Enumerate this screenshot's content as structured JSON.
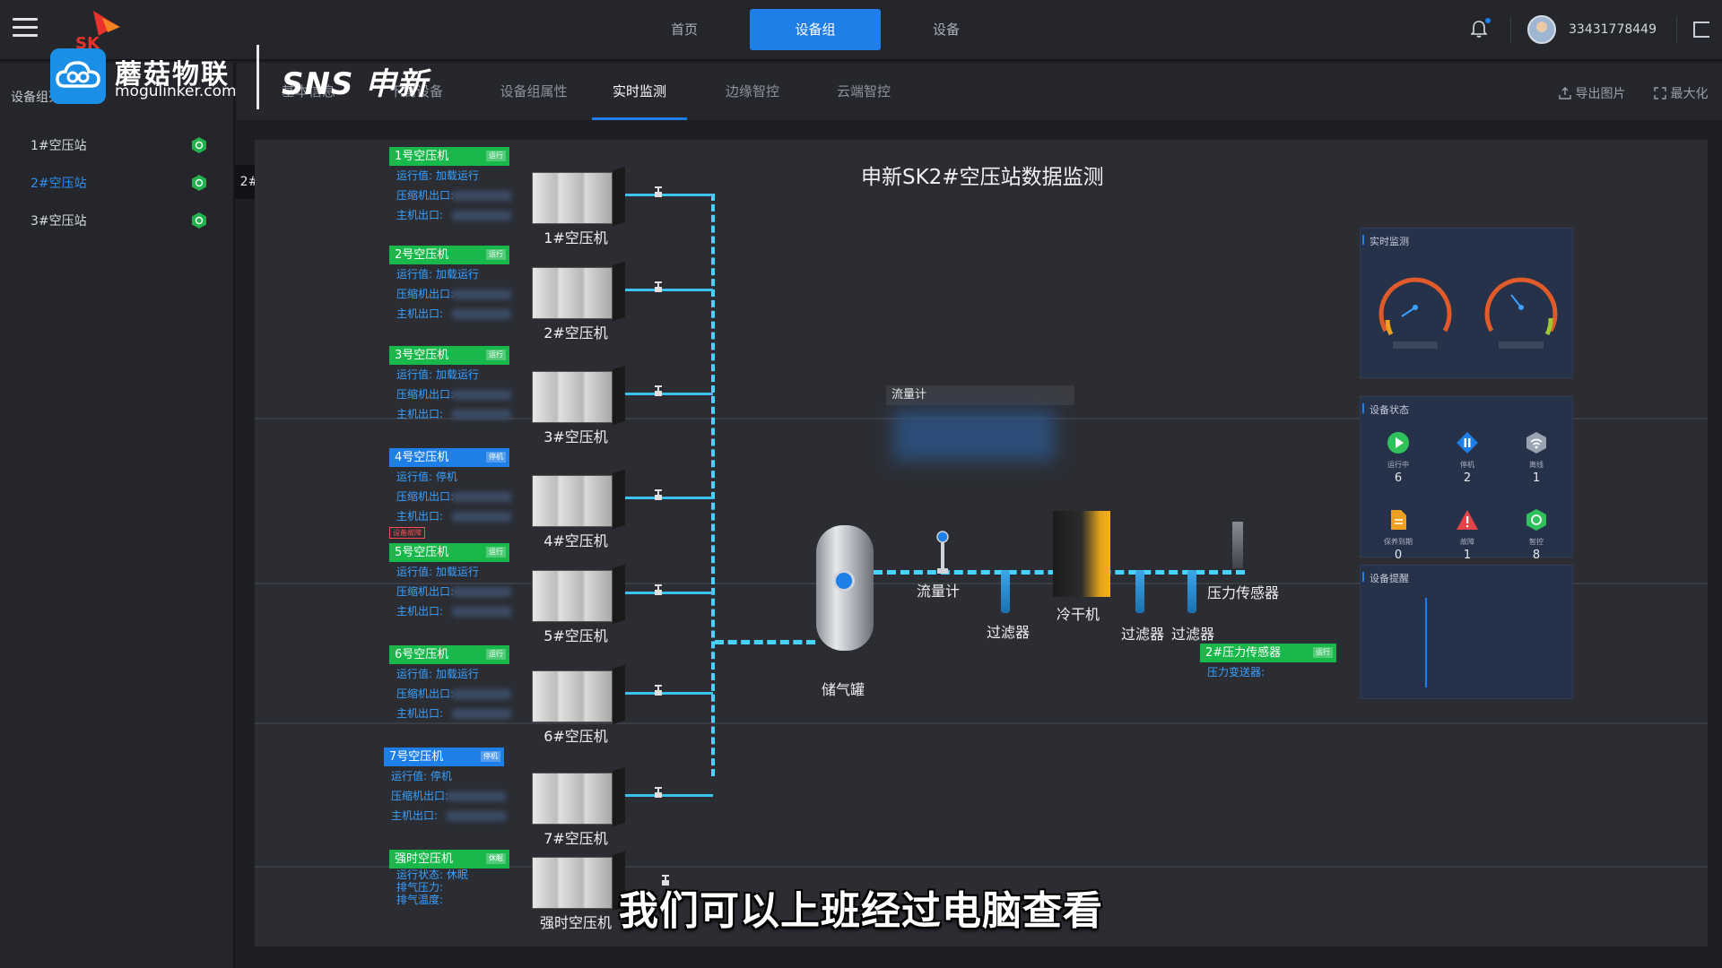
{
  "topbar": {
    "nav": [
      {
        "label": "首页",
        "active": false
      },
      {
        "label": "设备组",
        "active": true
      },
      {
        "label": "设备",
        "active": false
      }
    ],
    "username": "33431778449"
  },
  "logo": {
    "cn": "蘑菇物联",
    "en": "mogulinker.com",
    "partner": "SNS 申新"
  },
  "sidebar": {
    "title": "设备组列",
    "stations": [
      {
        "label": "1#空压站",
        "active": false
      },
      {
        "label": "2#空压站",
        "active": true
      },
      {
        "label": "3#空压站",
        "active": false
      }
    ],
    "tooltip": "2#空压站"
  },
  "subtabs": [
    "基本信息",
    "下属设备",
    "设备组属性",
    "实时监测",
    "边缘智控",
    "云端智控"
  ],
  "tools": {
    "export": "导出图片",
    "maximize": "最大化"
  },
  "diagram": {
    "title": "申新SK2#空压站数据监测",
    "compressors": [
      {
        "name": "1号空压机",
        "status": "运行",
        "run_label": "运行值:",
        "run_value": "加载运行",
        "outlet_label": "压缩机出口:",
        "main_label": "主机出口:",
        "machine": "1#空压机"
      },
      {
        "name": "2号空压机",
        "status": "运行",
        "run_label": "运行值:",
        "run_value": "加载运行",
        "outlet_label": "压缩机出口:",
        "main_label": "主机出口:",
        "machine": "2#空压机"
      },
      {
        "name": "3号空压机",
        "status": "运行",
        "run_label": "运行值:",
        "run_value": "加载运行",
        "outlet_label": "压缩机出口:",
        "main_label": "主机出口:",
        "machine": "3#空压机"
      },
      {
        "name": "4号空压机",
        "status": "停机",
        "run_label": "运行值:",
        "run_value": "停机",
        "outlet_label": "压缩机出口:",
        "main_label": "主机出口:",
        "machine": "4#空压机",
        "fault": "设备故障"
      },
      {
        "name": "5号空压机",
        "status": "运行",
        "run_label": "运行值:",
        "run_value": "加载运行",
        "outlet_label": "压缩机出口:",
        "main_label": "主机出口:",
        "machine": "5#空压机"
      },
      {
        "name": "6号空压机",
        "status": "运行",
        "run_label": "运行值:",
        "run_value": "加载运行",
        "outlet_label": "压缩机出口:",
        "main_label": "主机出口:",
        "machine": "6#空压机"
      },
      {
        "name": "7号空压机",
        "status": "停机",
        "run_label": "运行值:",
        "run_value": "停机",
        "outlet_label": "压缩机出口:",
        "main_label": "主机出口:",
        "machine": "7#空压机"
      },
      {
        "name": "强时空压机",
        "status": "休眠",
        "run_label": "运行状态:",
        "run_value": "休眠",
        "outlet_label": "排气压力:",
        "main_label": "排气温度:",
        "machine": "强时空压机"
      }
    ],
    "components": {
      "tank": "储气罐",
      "flowmeter": "流量计",
      "filter": "过滤器",
      "dryer": "冷干机",
      "pressure_sensor": "压力传感器"
    },
    "flow_box_label": "流量计",
    "pressure_card": {
      "name": "2#压力传感器",
      "status": "运行",
      "row": "压力变送器:"
    }
  },
  "right_panels": {
    "realtime": {
      "title": "实时监测"
    },
    "status": {
      "title": "设备状态",
      "items": [
        {
          "name": "运行中",
          "count": "6",
          "color": "#2fc25b",
          "icon": "play-icon"
        },
        {
          "name": "停机",
          "count": "2",
          "color": "#1e7fe8",
          "icon": "pause-diamond-icon"
        },
        {
          "name": "离线",
          "count": "1",
          "color": "#9aa3b2",
          "icon": "wifi-off-icon"
        },
        {
          "name": "保养到期",
          "count": "0",
          "color": "#f0a020",
          "icon": "file-icon"
        },
        {
          "name": "故障",
          "count": "1",
          "color": "#e64545",
          "icon": "warning-icon"
        },
        {
          "name": "智控",
          "count": "8",
          "color": "#2fc25b",
          "icon": "hex-sync-icon"
        }
      ]
    },
    "reminder": {
      "title": "设备提醒"
    }
  },
  "subtitle": "我们可以上班经过电脑查看"
}
